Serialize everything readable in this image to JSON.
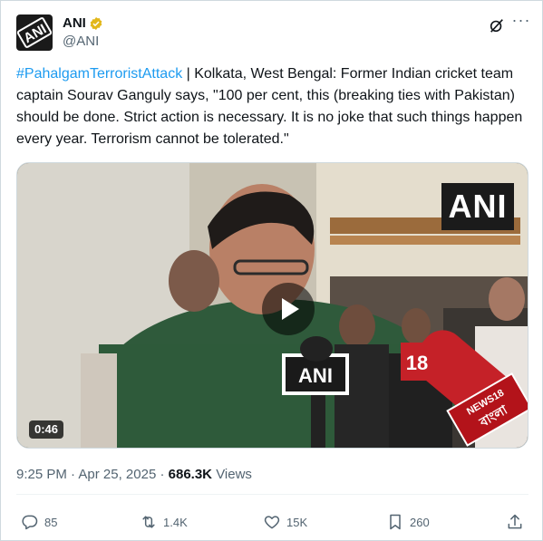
{
  "author": {
    "name": "ANI",
    "handle": "@ANI",
    "avatar_text": "ANI"
  },
  "tweet": {
    "hashtag": "#PahalgamTerroristAttack",
    "body": " | Kolkata, West Bengal: Former Indian cricket team captain Sourav Ganguly says, \"100 per cent, this (breaking ties with Pakistan) should be done. Strict action is necessary. It is no joke that such things happen every year. Terrorism cannot be tolerated.\""
  },
  "video": {
    "duration": "0:46",
    "watermark": "ANI",
    "mic_logo_ani": "ANI",
    "mic_logo_18": "18",
    "mic_logo_news18": "NEWS18",
    "mic_logo_bangla": "বাংলা"
  },
  "meta": {
    "time": "9:25 PM",
    "date": "Apr 25, 2025",
    "views_count": "686.3K",
    "views_label": "Views",
    "separator": "·"
  },
  "actions": {
    "replies": "85",
    "reposts": "1.4K",
    "likes": "15K",
    "bookmarks": "260"
  },
  "colors": {
    "link": "#1d9bf0",
    "secondary": "#536471",
    "verified_gold": "#e2b719"
  },
  "icons": [
    "verified-badge-icon",
    "grok-icon",
    "more-icon",
    "play-icon",
    "reply-icon",
    "repost-icon",
    "like-icon",
    "bookmark-icon",
    "share-icon"
  ]
}
